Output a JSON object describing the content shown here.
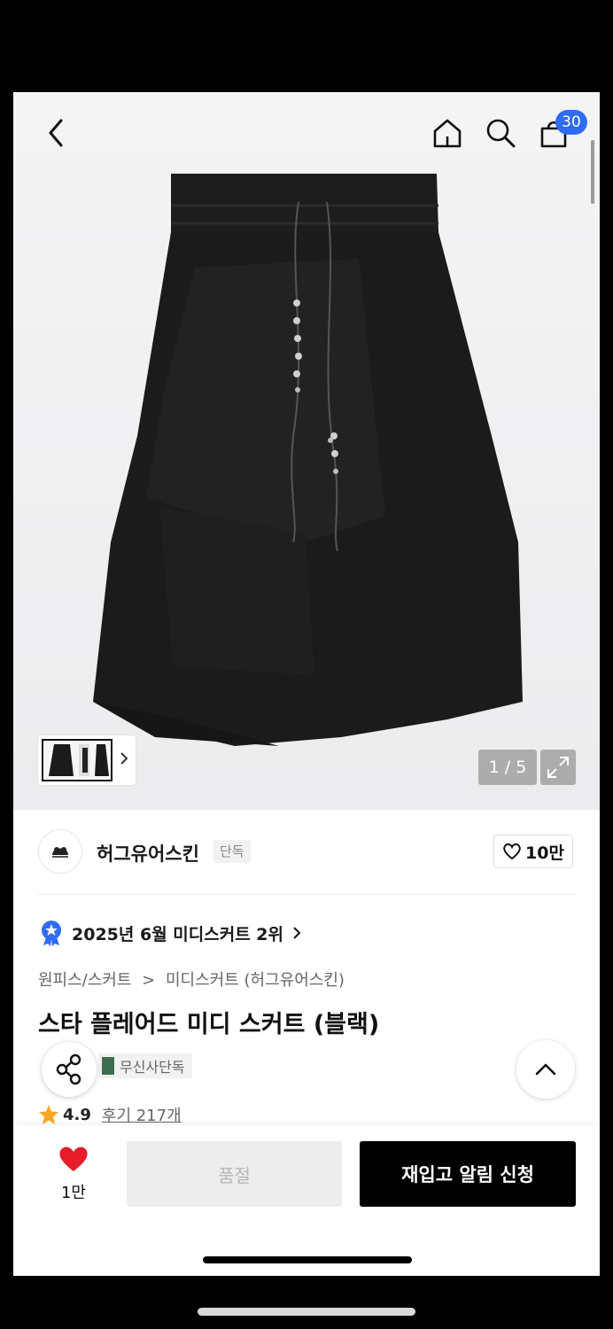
{
  "header": {
    "cart_count": "30"
  },
  "gallery": {
    "pager": "1 / 5"
  },
  "brand": {
    "name": "허그유어스킨",
    "tag": "단독",
    "like_count": "10만"
  },
  "rank": {
    "text": "2025년 6월 미디스커트 2위"
  },
  "breadcrumb": {
    "category": "원피스/스커트",
    "sep": ">",
    "sub": "미디스커트 (허그유어스킨)"
  },
  "product": {
    "title": "스타 플레어드 미디 스커트 (블랙)",
    "tag": "무신사단독",
    "rating": "4.9",
    "review": "후기 217개"
  },
  "bottom_bar": {
    "like_count": "1만",
    "soldout": "품절",
    "restock": "재입고 알림 신청"
  },
  "colors": {
    "accent": "#2f6bf5",
    "heart": "#e51d2a",
    "star": "#f5a623"
  }
}
